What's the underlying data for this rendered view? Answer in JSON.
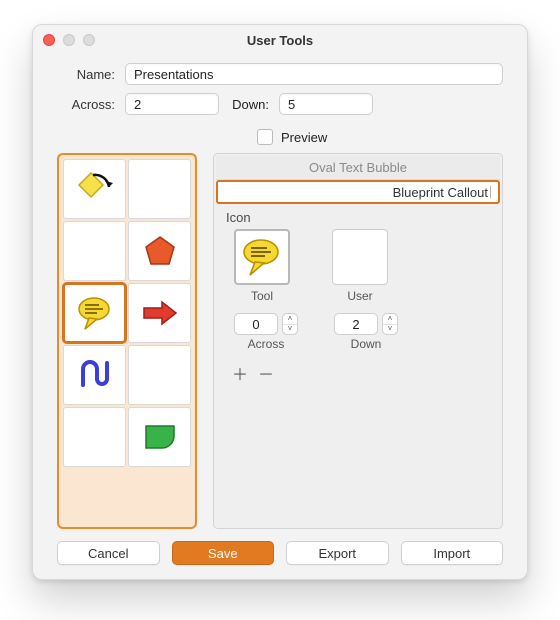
{
  "window": {
    "title": "User Tools"
  },
  "form": {
    "name_label": "Name:",
    "name_value": "Presentations",
    "across_label": "Across:",
    "across_value": "2",
    "down_label": "Down:",
    "down_value": "5",
    "preview_label": "Preview"
  },
  "grid": {
    "selected_index": 4,
    "cells": [
      {
        "icon": "diamond-arrow"
      },
      {
        "icon": ""
      },
      {
        "icon": ""
      },
      {
        "icon": "pentagon"
      },
      {
        "icon": "speech"
      },
      {
        "icon": "arrow-right"
      },
      {
        "icon": "squiggle"
      },
      {
        "icon": ""
      },
      {
        "icon": ""
      },
      {
        "icon": "rounded-rect"
      }
    ]
  },
  "detail": {
    "list": [
      {
        "label": "Oval Text Bubble",
        "selected": false
      },
      {
        "label": "Blueprint Callout",
        "selected": true
      }
    ],
    "icon_heading": "Icon",
    "tool_icon_label": "Tool",
    "user_icon_label": "User",
    "coord_across_label": "Across",
    "coord_across_value": "0",
    "coord_down_label": "Down",
    "coord_down_value": "2"
  },
  "buttons": {
    "cancel": "Cancel",
    "save": "Save",
    "export": "Export",
    "import": "Import"
  }
}
